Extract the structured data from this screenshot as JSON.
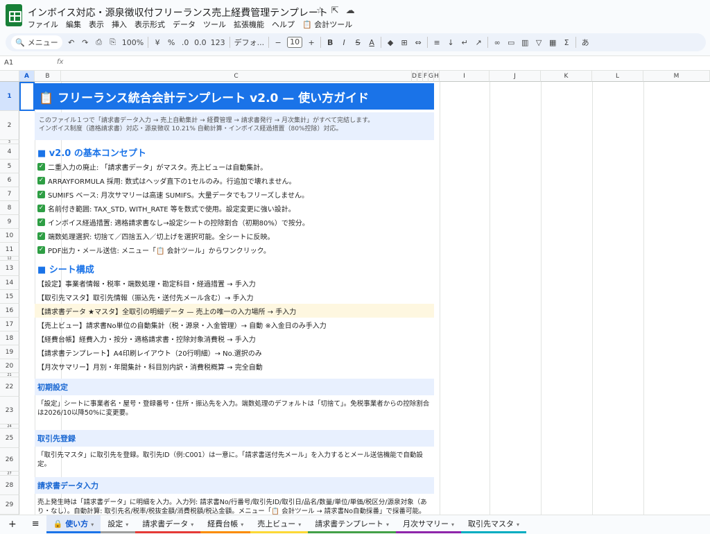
{
  "app": {
    "doc_title": "インボイス対応・源泉徴収付フリーランス売上経費管理テンプレート",
    "title_icons": [
      "☆",
      "⇱",
      "☁"
    ]
  },
  "menu": [
    "ファイル",
    "編集",
    "表示",
    "挿入",
    "表示形式",
    "データ",
    "ツール",
    "拡張機能",
    "ヘルプ",
    "📋 会計ツール"
  ],
  "toolbar": {
    "search": "メニュー",
    "zoom": "100%",
    "font": "デフォ...",
    "font_size": "10",
    "items": [
      "↶",
      "↷",
      "⎙",
      "⎘",
      "¥",
      "%",
      ".0",
      "0.0",
      "123"
    ]
  },
  "formula": {
    "cell_ref": "A1",
    "fx": "fx"
  },
  "columns": [
    "A",
    "B",
    "C",
    "D",
    "E",
    "F",
    "G",
    "H",
    "I",
    "J",
    "K",
    "L",
    "M"
  ],
  "rows": [
    "1",
    "2",
    "3",
    "4",
    "5",
    "6",
    "7",
    "8",
    "9",
    "10",
    "11",
    "12",
    "13",
    "14",
    "15",
    "16",
    "17",
    "18",
    "19",
    "20",
    "21",
    "22",
    "23",
    "24",
    "25",
    "26",
    "27",
    "28",
    "29"
  ],
  "sheet": {
    "title": "📋 フリーランス統合会計テンプレート v2.0 — 使い方ガイド",
    "desc_line1": "このファイル１つで「請求書データ入力 → 売上自動集計 → 経費管理 → 請求書発行 → 月次集計」がすべて完結します。",
    "desc_line2": "インボイス制度（適格請求書）対応・源泉徴収 10.21% 自動計算・インボイス経過措置（80%控除）対応。",
    "sec1": "■ v2.0 の基本コンセプト",
    "concepts": [
      "二重入力の廃止: 「請求書データ」がマスタ。売上ビューは自動集計。",
      "ARRAYFORMULA 採用: 数式はヘッダ直下の1セルのみ。行追加で壊れません。",
      "SUMIFS ベース: 月次サマリーは高速 SUMIFS。大量データでもフリーズしません。",
      "名前付き範囲: TAX_STD, WITH_RATE 等を数式で使用。設定変更に強い設計。",
      "インボイス経過措置: 適格請求書なし→設定シートの控除割合（初期80%）で按分。",
      "端数処理選択: 切捨て／四捨五入／切上げを選択可能。全シートに反映。",
      "PDF出力・メール送信: メニュー「📋 会計ツール」からワンクリック。"
    ],
    "sec2": "■ シート構成",
    "sheets": [
      "【設定】事業者情報・税率・端数処理・勘定科目・経過措置 → 手入力",
      "【取引先マスタ】取引先情報（振込先・送付先メール含む）→ 手入力",
      "【請求書データ ★マスタ】全取引の明細データ — 売上の唯一の入力場所 → 手入力",
      "【売上ビュー】請求書No単位の自動集計（税・源泉・入金管理）→ 自動 ※入金日のみ手入力",
      "【経費台帳】経費入力・按分・適格請求書・控除対象消費税 → 手入力",
      "【請求書テンプレート】A4印刷レイアウト（20行明細）→ No.選択のみ",
      "【月次サマリー】月別・年間集計・科目別内訳・消費税概算 → 完全自動"
    ],
    "blk1": "初期設定",
    "p1": "「設定」シートに事業者名・屋号・登録番号・住所・振込先を入力。端数処理のデフォルトは「切捨て」。免税事業者からの控除割合は2026/10以降50%に変更要。",
    "blk2": "取引先登録",
    "p2": "「取引先マスタ」に取引先を登録。取引先ID（例:C001）は一意に。「請求書送付先メール」を入力するとメール送信機能で自動設定。",
    "blk3": "請求書データ入力",
    "p3": "売上発生時は「請求書データ」に明細を入力。入力列: 請求書No/行番号/取引先ID/取引日/品名/数量/単位/単価/税区分/源泉対象（あり・なし）。自動計算: 取引先名/税率/税抜金額/消費税額/税込金額。メニュー「📋 会計ツール → 請求書No自動採番」で採番可能。"
  },
  "tabs": [
    "使い方",
    "設定",
    "請求書データ",
    "経費台帳",
    "売上ビュー",
    "請求書テンプレート",
    "月次サマリー",
    "取引先マスタ"
  ],
  "tab_colors": [
    "#1a73e8",
    "#9e9e9e",
    "#e53935",
    "#fb8c00",
    "#fdd835",
    "#43a047",
    "#8e24aa",
    "#00acc1"
  ]
}
